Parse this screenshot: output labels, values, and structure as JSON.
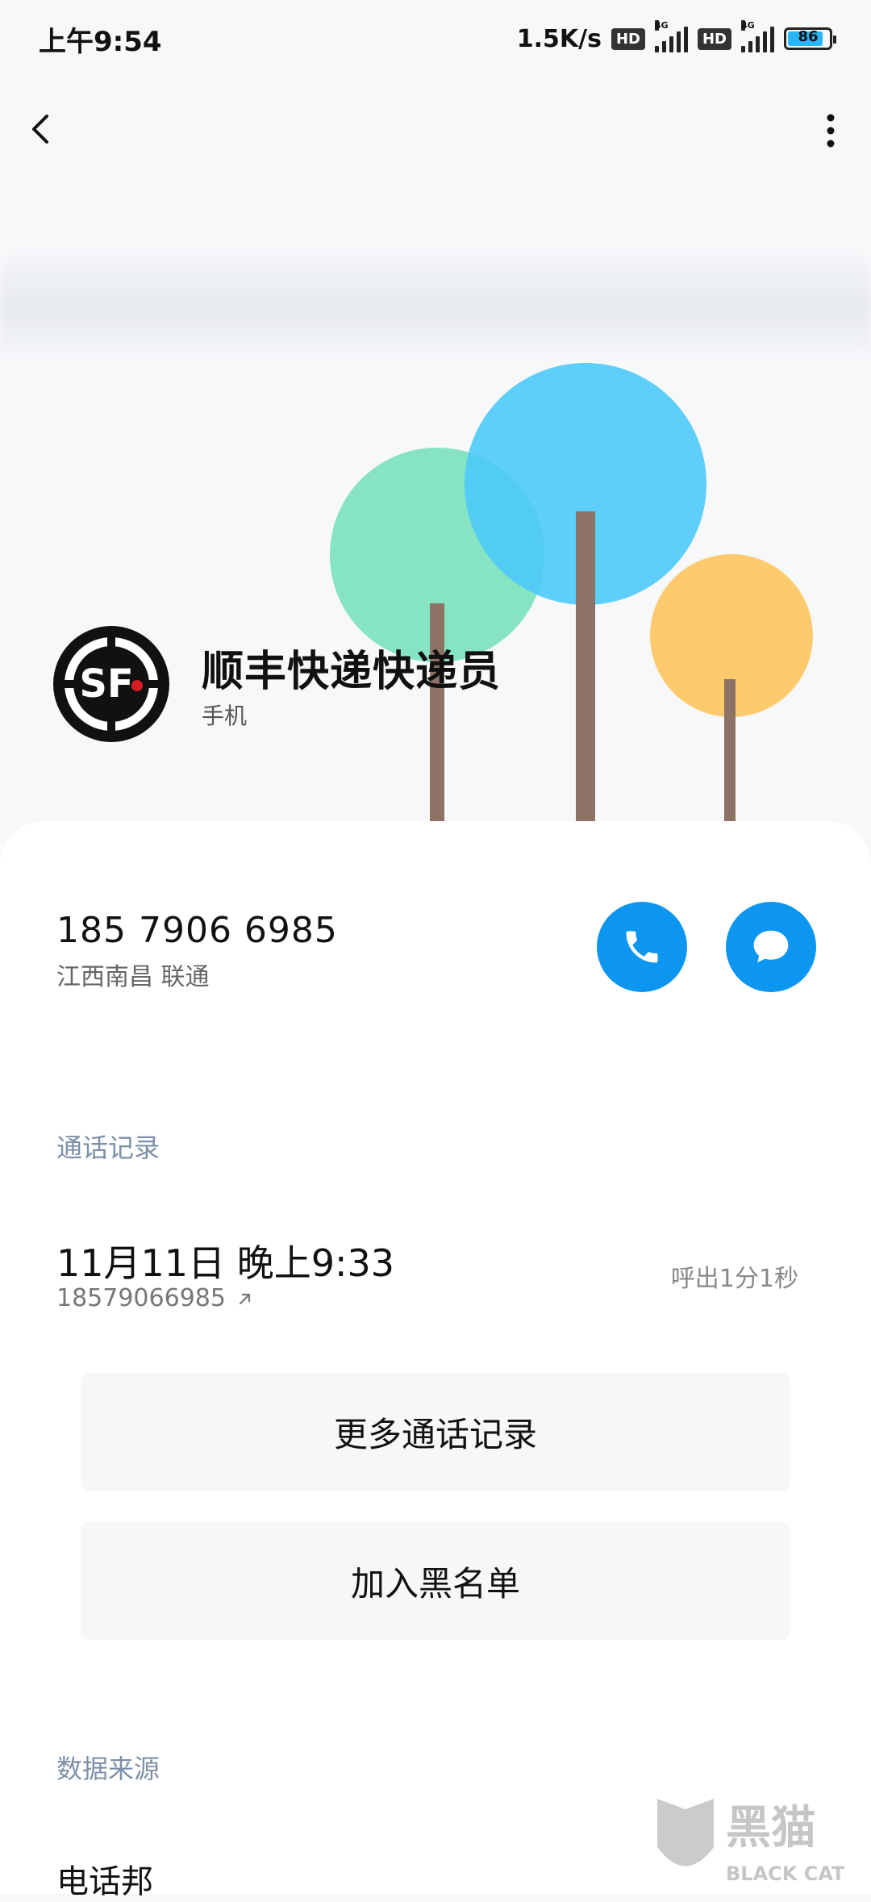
{
  "status_bar": {
    "time": "上午9:54",
    "speed": "1.5K/s",
    "hd_label": "HD",
    "network_label": "4G",
    "battery": "86"
  },
  "contact": {
    "name": "顺丰快递快递员",
    "label": "手机",
    "avatar_text": "SF"
  },
  "phone": {
    "number": "185 7906 6985",
    "location": "江西南昌 联通"
  },
  "call_log": {
    "title": "通话记录",
    "entry": {
      "datetime": "11月11日 晚上9:33",
      "number": "18579066985",
      "type_duration": "呼出1分1秒"
    }
  },
  "actions": {
    "more_logs": "更多通话记录",
    "blacklist": "加入黑名单"
  },
  "data_source": {
    "title": "数据来源",
    "name": "电话邦"
  },
  "watermark": {
    "text_cn": "黑猫",
    "text_en": "BLACK CAT"
  },
  "colors": {
    "accent": "#0d96f0",
    "tree_green": "#7fe3bf",
    "tree_blue": "#4cc9fb",
    "tree_yellow": "#fdcb6e",
    "trunk": "#8d7266"
  },
  "icons": {
    "back": "chevron-left-icon",
    "more": "more-vertical-icon",
    "call": "phone-icon",
    "message": "message-icon",
    "outgoing": "outgoing-arrow-icon"
  }
}
